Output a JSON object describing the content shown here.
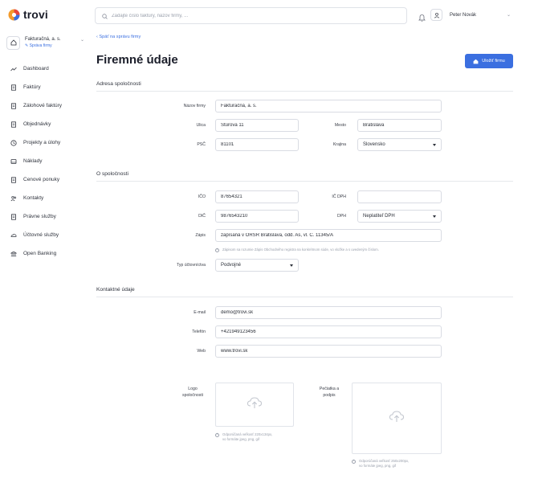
{
  "app": {
    "logo_text": "trovi"
  },
  "company": {
    "name": "Fakturačná, a. s.",
    "manage_link": "Správa firmy"
  },
  "nav": [
    {
      "label": "Dashboard",
      "icon": "trend-icon"
    },
    {
      "label": "Faktúry",
      "icon": "document-icon"
    },
    {
      "label": "Zálohové faktúry",
      "icon": "document-icon"
    },
    {
      "label": "Objednávky",
      "icon": "document-icon"
    },
    {
      "label": "Projekty a úlohy",
      "icon": "clock-icon"
    },
    {
      "label": "Náklady",
      "icon": "box-icon"
    },
    {
      "label": "Cenové ponuky",
      "icon": "document-icon"
    },
    {
      "label": "Kontakty",
      "icon": "people-icon"
    },
    {
      "label": "Právne služby",
      "icon": "document-icon"
    },
    {
      "label": "Účtovné služby",
      "icon": "cloud-icon"
    },
    {
      "label": "Open Banking",
      "icon": "bank-icon"
    }
  ],
  "topbar": {
    "search_placeholder": "Zadajte číslo faktúry, názov firmy, ...",
    "user_name": "Peter Novák"
  },
  "page": {
    "back_link": "‹ Späť na správu firmy",
    "title": "Firemné údaje",
    "save_label": "Uložiť firmu"
  },
  "colors": {
    "accent": "#3b6fe0",
    "border": "#d9dce3"
  },
  "address": {
    "section_title": "Adresa spoločnosti",
    "company_name_label": "Názov firmy",
    "company_name_value": "Fakturačná, a. s.",
    "street_label": "Ulica",
    "street_value": "Štúrova 11",
    "city_label": "Mesto",
    "city_value": "Bratislava",
    "zip_label": "PSČ",
    "zip_value": "81101",
    "country_label": "Krajina",
    "country_value": "Slovensko"
  },
  "about": {
    "section_title": "O spoločnosti",
    "ico_label": "IČO",
    "ico_value": "87654321",
    "icdph_label": "IČ DPH",
    "icdph_value": "",
    "dic_label": "DIČ",
    "dic_value": "9876543210",
    "dph_label": "DPH",
    "dph_value": "Neplatiteľ DPH",
    "register_label": "Zápis",
    "register_value": "zapísaná v ORSR Bratislava, odd. As, vl. Č. 11345/A",
    "register_hint": "Zápisom sa rozumie Zápis Obchodného registra na konkrétnom súde, vo vložke a s uvedeným číslom.",
    "accounting_label": "Typ účtovníctva",
    "accounting_value": "Podvojné"
  },
  "contact": {
    "section_title": "Kontaktné údaje",
    "email_label": "E-mail",
    "email_value": "demo@trovi.sk",
    "phone_label": "Telefón",
    "phone_value": "+421949123456",
    "web_label": "Web",
    "web_value": "www.trovi.sk",
    "logo_label_1": "Logo",
    "logo_label_2": "spoločnosti",
    "logo_hint_1": "Odporúčaná veľkosť 220x134px,",
    "logo_hint_2": "vo formáte jpeg, png, gif",
    "stamp_label_1": "Pečiatka a",
    "stamp_label_2": "podpis",
    "stamp_hint_1": "Odporúčaná veľkosť 250x200px,",
    "stamp_hint_2": "vo formáte jpeg, png, gif"
  }
}
